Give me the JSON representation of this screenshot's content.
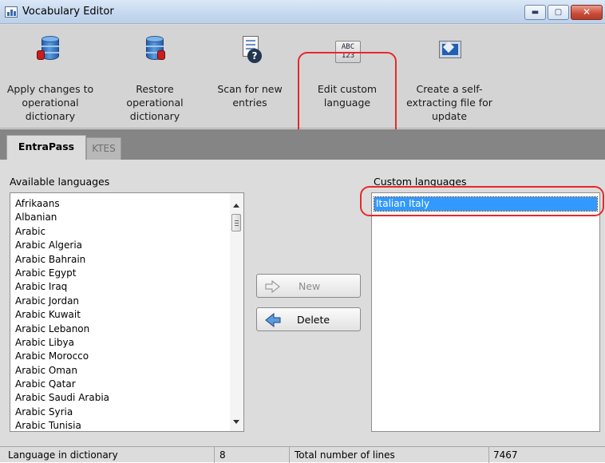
{
  "window": {
    "title": "Vocabulary Editor",
    "controls": {
      "minimize": "▬",
      "maximize": "▢",
      "close": "✕"
    }
  },
  "toolbar": {
    "items": [
      {
        "label_line1": "Apply changes to",
        "label_line2": "operational",
        "label_line3": "dictionary",
        "icon": "database-apply-icon"
      },
      {
        "label_line1": "Restore",
        "label_line2": "operational",
        "label_line3": "dictionary",
        "icon": "database-restore-icon"
      },
      {
        "label_line1": "Scan for new",
        "label_line2": "entries",
        "label_line3": "",
        "icon": "scan-entries-icon"
      },
      {
        "label_line1": "Edit custom",
        "label_line2": "language",
        "label_line3": "",
        "icon": "abc-123-icon"
      },
      {
        "label_line1": "Create a self-",
        "label_line2": "extracting file for",
        "label_line3": "update",
        "icon": "monitor-export-icon"
      }
    ],
    "abc_top": "ABC",
    "abc_bottom": "123"
  },
  "tabs": [
    {
      "label": "EntraPass",
      "active": true
    },
    {
      "label": "KTES",
      "active": false
    }
  ],
  "available": {
    "label": "Available languages",
    "items": [
      "Afrikaans",
      "Albanian",
      "Arabic",
      "Arabic Algeria",
      "Arabic Bahrain",
      "Arabic Egypt",
      "Arabic Iraq",
      "Arabic Jordan",
      "Arabic Kuwait",
      "Arabic Lebanon",
      "Arabic Libya",
      "Arabic Morocco",
      "Arabic Oman",
      "Arabic Qatar",
      "Arabic Saudi Arabia",
      "Arabic Syria",
      "Arabic Tunisia"
    ]
  },
  "actions": {
    "new_label": "New",
    "delete_label": "Delete"
  },
  "custom": {
    "label": "Custom languages",
    "items": [
      "Italian Italy"
    ]
  },
  "status": {
    "lang_label": "Language in dictionary",
    "lang_count": "8",
    "lines_label": "Total number of lines",
    "lines_count": "7467"
  },
  "colors": {
    "selection": "#3399ff",
    "highlight_ring": "#e8282a"
  }
}
